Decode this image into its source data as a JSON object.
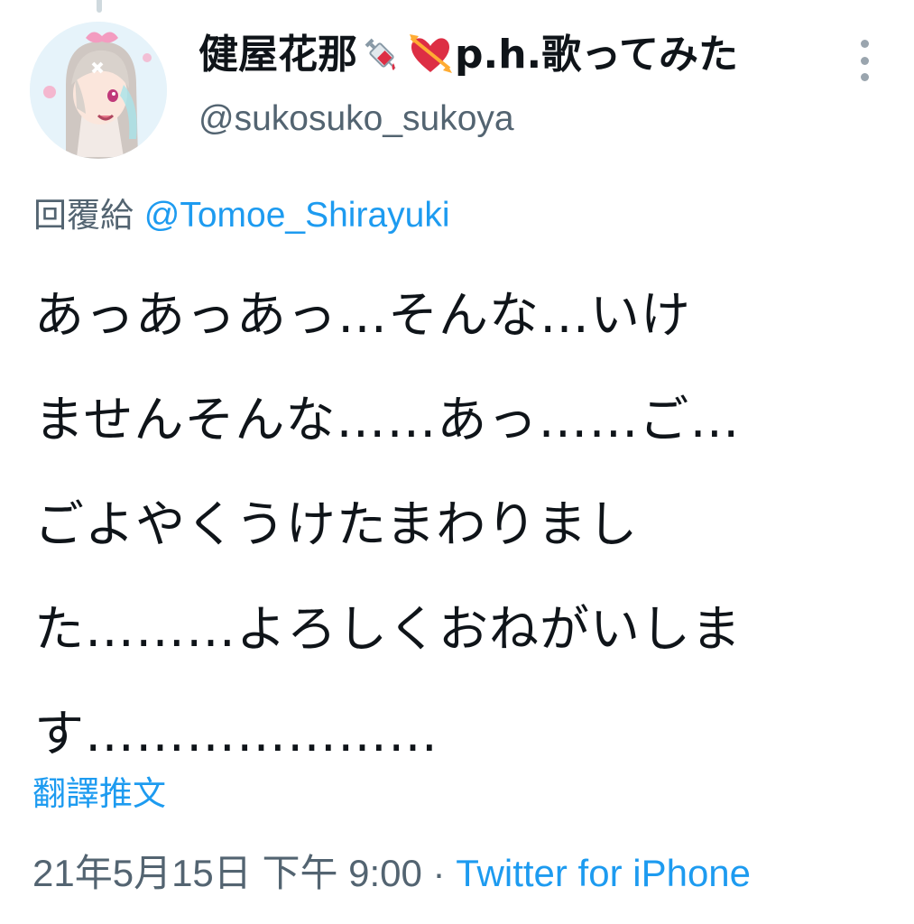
{
  "author": {
    "display_name": "健屋花那",
    "name_suffix": "p.h.歌ってみた",
    "name_emojis": [
      "syringe-icon",
      "heart-with-arrow-icon"
    ],
    "handle": "@sukosuko_sukoya"
  },
  "reply": {
    "prefix": "回覆給",
    "mention": "@Tomoe_Shirayuki"
  },
  "tweet": {
    "text": "あっあっあっ…そんな…いけ\nませんそんな……あっ……ご…\nごよやくうけたまわりまし\nた………よろしくおねがいしま\nす…………………"
  },
  "translate_label": "翻譯推文",
  "meta": {
    "timestamp": "21年5月15日 下午 9:00",
    "separator": " · ",
    "source": "Twitter for iPhone"
  },
  "colors": {
    "link": "#1d9bf0",
    "secondary_text": "#536471",
    "primary_text": "#0f1419"
  }
}
